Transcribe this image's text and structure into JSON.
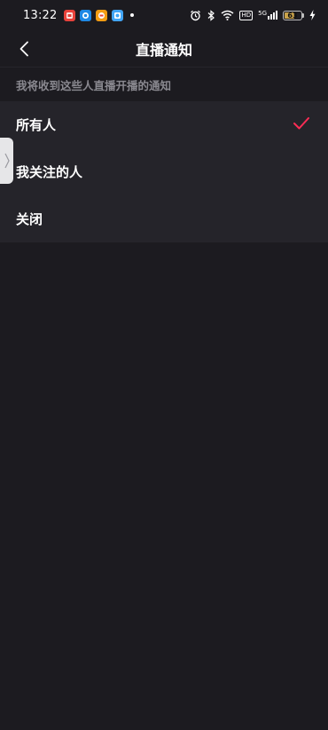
{
  "status_bar": {
    "time": "13:22",
    "notification_icons": [
      {
        "name": "app-red-icon",
        "color": "#e8423b",
        "glyph": "●"
      },
      {
        "name": "app-blue-icon",
        "color": "#1e88e5",
        "glyph": "◉"
      },
      {
        "name": "app-orange-icon",
        "color": "#f39c12",
        "glyph": "◆"
      },
      {
        "name": "app-lightblue-icon",
        "color": "#42a5f5",
        "glyph": "■"
      }
    ],
    "hd_label": "HD",
    "network_label": "5G",
    "battery_level": "63",
    "battery_fraction": 0.63
  },
  "header": {
    "title": "直播通知",
    "back_icon": "chevron-left-icon"
  },
  "section": {
    "label": "我将收到这些人直播开播的通知"
  },
  "options": [
    {
      "label": "所有人",
      "selected": true
    },
    {
      "label": "我关注的人",
      "selected": false
    },
    {
      "label": "关闭",
      "selected": false
    }
  ],
  "colors": {
    "background": "#1c1b20",
    "option_background": "#25242a",
    "check": "#fe2c55",
    "muted_text": "#8a8990"
  }
}
